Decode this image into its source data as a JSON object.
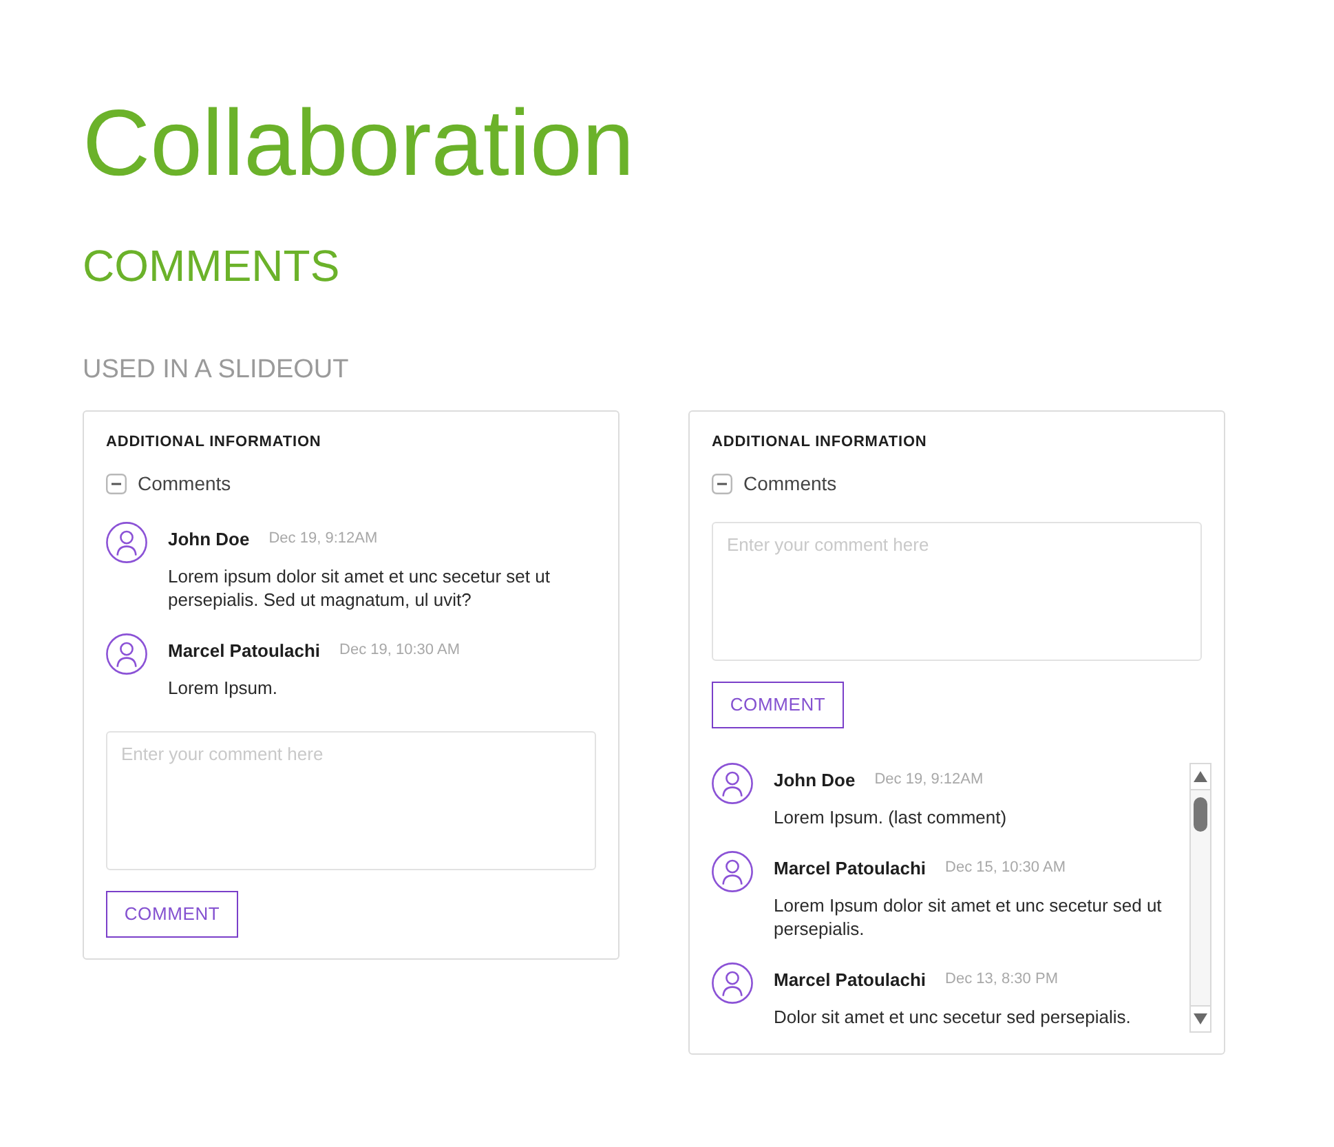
{
  "page": {
    "title": "Collaboration",
    "heading": "COMMENTS",
    "subheading": "USED IN A SLIDEOUT"
  },
  "panels": [
    {
      "kind": "list-first",
      "title": "ADDITIONAL INFORMATION",
      "section": {
        "label": "Comments",
        "expanded": true
      },
      "comments": [
        {
          "author": "John Doe",
          "time": "Dec 19, 9:12AM",
          "text": "Lorem ipsum dolor sit amet et unc secetur set ut persepialis. Sed ut magnatum, ul uvit?"
        },
        {
          "author": "Marcel Patoulachi",
          "time": "Dec 19, 10:30 AM",
          "text": "Lorem Ipsum."
        }
      ],
      "input": {
        "placeholder": "Enter your comment here"
      },
      "button": "COMMENT"
    },
    {
      "kind": "input-first",
      "title": "ADDITIONAL INFORMATION",
      "section": {
        "label": "Comments",
        "expanded": true
      },
      "input": {
        "placeholder": "Enter your comment here"
      },
      "button": "COMMENT",
      "comments": [
        {
          "author": "John Doe",
          "time": "Dec 19, 9:12AM",
          "text": "Lorem Ipsum. (last comment)"
        },
        {
          "author": "Marcel Patoulachi",
          "time": "Dec 15, 10:30 AM",
          "text": "Lorem Ipsum dolor sit amet et unc secetur sed ut persepialis."
        },
        {
          "author": "Marcel Patoulachi",
          "time": "Dec 13, 8:30 PM",
          "text": "Dolor sit amet et unc secetur sed persepialis."
        }
      ]
    }
  ]
}
